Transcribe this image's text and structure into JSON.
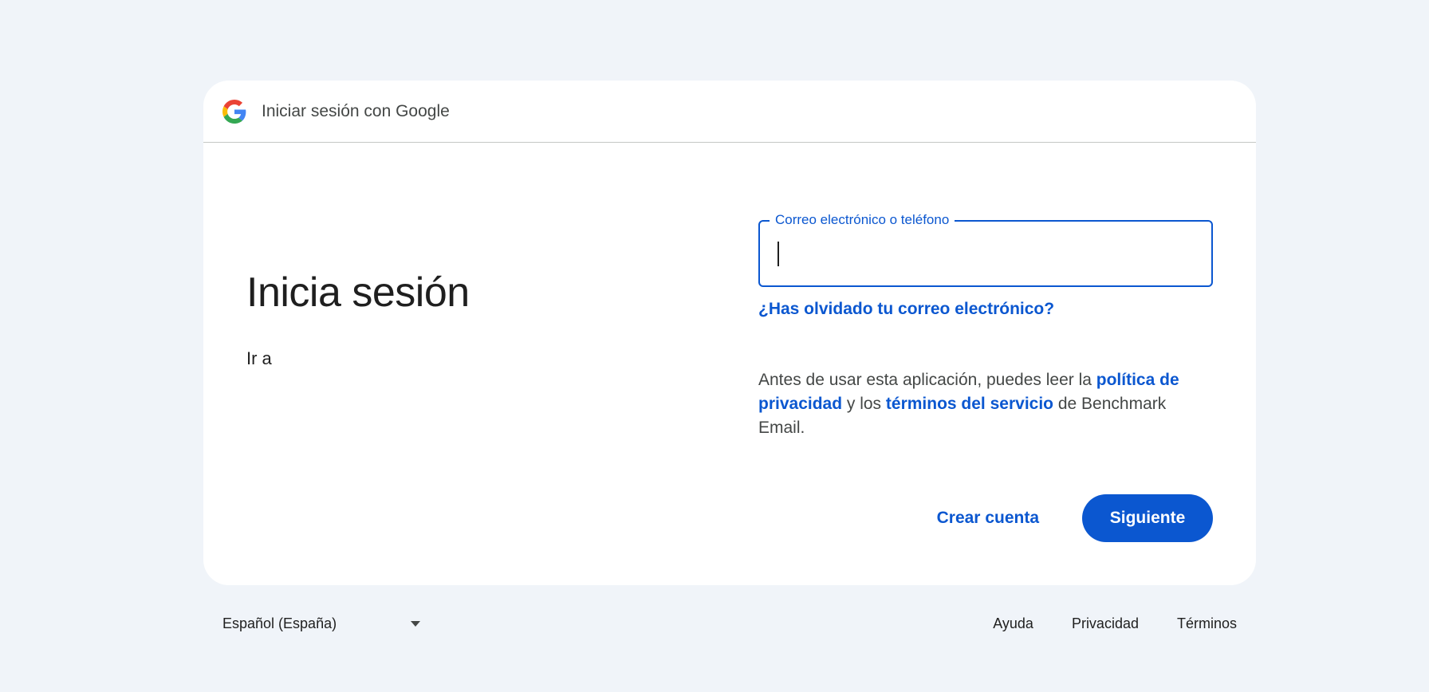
{
  "header": {
    "title": "Iniciar sesión con Google",
    "logo_icon": "google-g-logo-icon"
  },
  "left": {
    "heading": "Inicia sesión",
    "subtext": "Ir a"
  },
  "form": {
    "email_label": "Correo electrónico o teléfono",
    "email_value": "",
    "forgot_link": "¿Has olvidado tu correo electrónico?"
  },
  "privacy": {
    "prefix": "Antes de usar esta aplicación, puedes leer la ",
    "policy_link": "política de privacidad",
    "middle": " y los ",
    "terms_link": "términos del servicio",
    "suffix": " de Benchmark Email."
  },
  "actions": {
    "create_account": "Crear cuenta",
    "next": "Siguiente"
  },
  "footer": {
    "language": "Español (España)",
    "links": [
      "Ayuda",
      "Privacidad",
      "Términos"
    ]
  },
  "colors": {
    "accent": "#0b57d0",
    "background": "#f0f4f9",
    "card": "#ffffff"
  }
}
